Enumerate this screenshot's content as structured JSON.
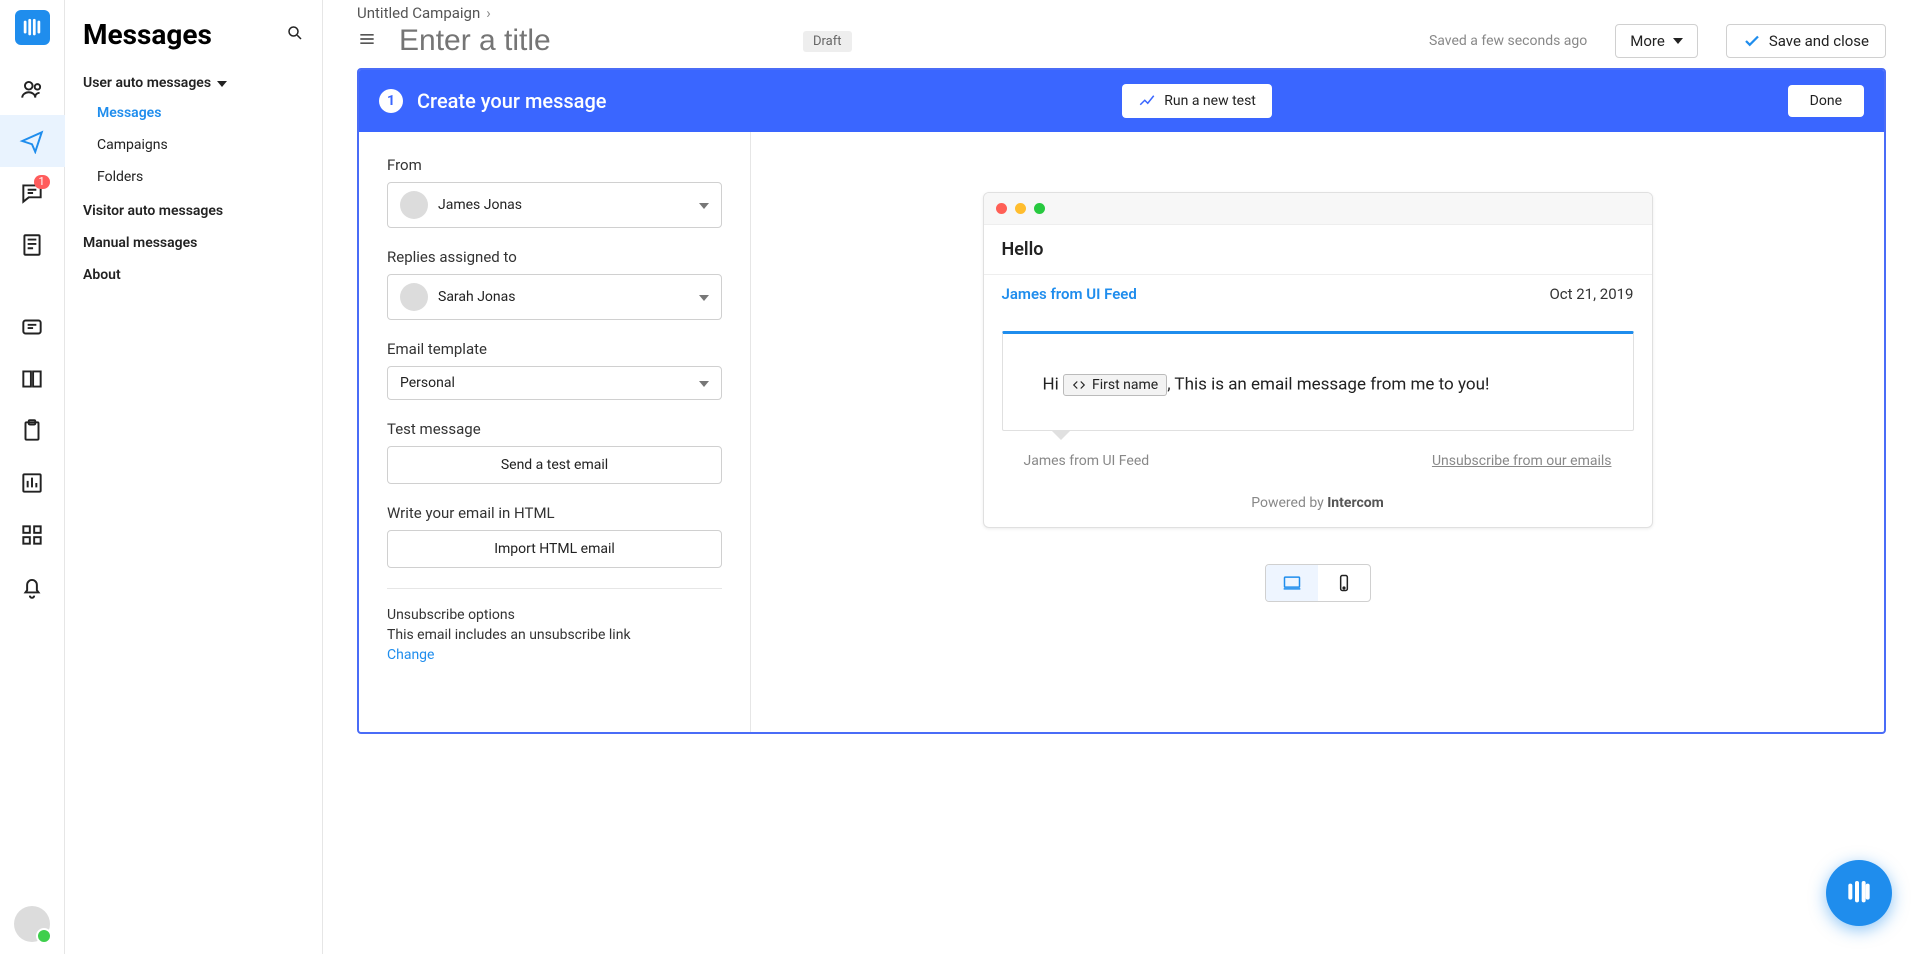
{
  "nav": {
    "title": "Messages",
    "sections": {
      "user_auto": "User auto messages",
      "visitor_auto": "Visitor auto messages",
      "manual": "Manual messages",
      "about": "About"
    },
    "links": {
      "messages": "Messages",
      "campaigns": "Campaigns",
      "folders": "Folders"
    },
    "badge_count": "1"
  },
  "crumb": {
    "campaign": "Untitled Campaign"
  },
  "title": {
    "placeholder": "Enter a title",
    "draft_chip": "Draft",
    "saved_text": "Saved a few seconds ago",
    "more_label": "More",
    "save_label": "Save and close"
  },
  "builder": {
    "step_num": "1",
    "step_title": "Create your message",
    "run_label": "Run a new test",
    "done_label": "Done"
  },
  "form": {
    "from_label": "From",
    "from_value": "James Jonas",
    "replies_label": "Replies assigned to",
    "replies_value": "Sarah Jonas",
    "template_label": "Email template",
    "template_value": "Personal",
    "test_label": "Test message",
    "test_btn": "Send a test email",
    "write_label": "Write your email in HTML",
    "import_btn": "Import HTML email",
    "unsub_title": "Unsubscribe options",
    "unsub_text": "This email includes an unsubscribe link",
    "change_link": "Change"
  },
  "preview": {
    "subject": "Hello",
    "from_line": "James from UI Feed",
    "date": "Oct 21, 2019",
    "greeting_prefix": "Hi ",
    "token_label": "First name",
    "greeting_suffix": ", This is an email message from me to you!",
    "footer_from": "James from UI Feed",
    "unsub_link": "Unsubscribe from our emails",
    "powered_prefix": "Powered by ",
    "powered_brand": "Intercom"
  }
}
